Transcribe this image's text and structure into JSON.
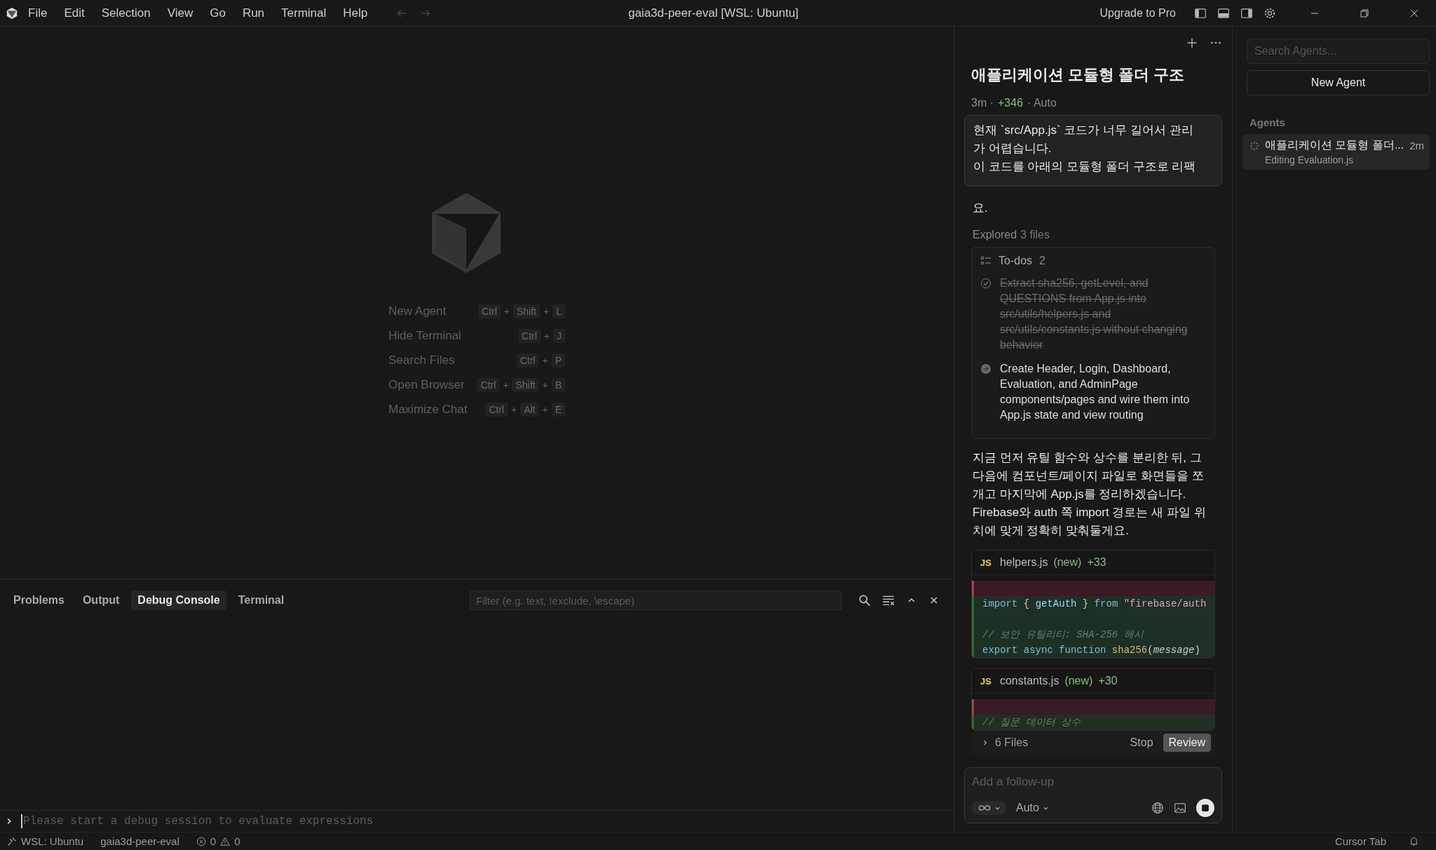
{
  "title_bar": {
    "menu": [
      "File",
      "Edit",
      "Selection",
      "View",
      "Go",
      "Run",
      "Terminal",
      "Help"
    ],
    "title": "gaia3d-peer-eval [WSL: Ubuntu]",
    "upgrade": "Upgrade to Pro"
  },
  "welcome": {
    "shortcuts": [
      {
        "label": "New Agent",
        "keys": [
          "Ctrl",
          "+",
          "Shift",
          "+",
          "L"
        ]
      },
      {
        "label": "Hide Terminal",
        "keys": [
          "Ctrl",
          "+",
          "J"
        ]
      },
      {
        "label": "Search Files",
        "keys": [
          "Ctrl",
          "+",
          "P"
        ]
      },
      {
        "label": "Open Browser",
        "keys": [
          "Ctrl",
          "+",
          "Shift",
          "+",
          "B"
        ]
      },
      {
        "label": "Maximize Chat",
        "keys": [
          "Ctrl",
          "+",
          "Alt",
          "+",
          "E"
        ]
      }
    ]
  },
  "panel": {
    "tabs": [
      {
        "label": "Problems",
        "selected": false
      },
      {
        "label": "Output",
        "selected": false
      },
      {
        "label": "Debug Console",
        "selected": true
      },
      {
        "label": "Terminal",
        "selected": false
      }
    ],
    "filter": {
      "placeholder": "Filter (e.g. text, !exclude, \\escape)"
    },
    "console": {
      "placeholder": "Please start a debug session to evaluate expressions"
    }
  },
  "chat": {
    "title": "애플리케이션 모듈형 폴더 구조",
    "meta": [
      {
        "text": "3m ·",
        "kind": "plain"
      },
      {
        "text": "+346",
        "kind": "added"
      },
      {
        "text": "· Auto",
        "kind": "plain"
      }
    ],
    "user_message": [
      "현재 `src/App.js` 코드가 너무 길어서 관리",
      "가 어렵습니다.",
      "이 코드를 아래의 모듈형 폴더 구조로 리팩"
    ],
    "reply_tail": "요.",
    "explored": {
      "label": "Explored",
      "count": "3 files"
    },
    "todos": {
      "label": "To-dos",
      "count": "2",
      "items": [
        {
          "text": "Extract sha256, getLevel, and QUESTIONS from App.js into src/utils/helpers.js and src/utils/constants.js without changing behavior",
          "done": true
        },
        {
          "text": "Create Header, Login, Dashboard, Evaluation, and AdminPage components/pages and wire them into App.js state and view routing",
          "done": false
        }
      ]
    },
    "reply": "지금 먼저 유틸 함수와 상수를 분리한 뒤, 그 다음에 컴포넌트/페이지 파일로 화면들을 쪼개고 마지막에 App.js를 정리하겠습니다. Firebase와 auth 쪽 import 경로는 새 파일 위치에 맞게 정확히 맞춰둘게요.",
    "files": [
      {
        "badge": "JS",
        "name": "helpers.js",
        "status": "(new)",
        "added": "+33",
        "lines": [
          {
            "kind": "removed"
          },
          {
            "kind": "added",
            "tokens": [
              {
                "kind": "keyword",
                "text": "import"
              },
              {
                "kind": "plain",
                "text": " { "
              },
              {
                "kind": "name",
                "text": "getAuth"
              },
              {
                "kind": "plain",
                "text": " } "
              },
              {
                "kind": "keyword",
                "text": "from"
              },
              {
                "kind": "string",
                "text": " \"firebase/auth"
              }
            ]
          },
          {
            "kind": "added"
          },
          {
            "kind": "added",
            "tokens": [
              {
                "kind": "comment",
                "text": "// 보안 유틸리티: SHA-256 해시"
              }
            ]
          },
          {
            "kind": "added",
            "tokens": [
              {
                "kind": "keyword",
                "text": "export async function"
              },
              {
                "kind": "func",
                "text": " sha256"
              },
              {
                "kind": "plain",
                "text": "("
              },
              {
                "kind": "param",
                "text": "message"
              },
              {
                "kind": "plain",
                "text": ")"
              }
            ]
          }
        ]
      },
      {
        "badge": "JS",
        "name": "constants.js",
        "status": "(new)",
        "added": "+30",
        "lines": [
          {
            "kind": "removed"
          },
          {
            "kind": "added",
            "tokens": [
              {
                "kind": "comment",
                "text": "// 질문 데이터 상수"
              }
            ]
          }
        ]
      }
    ],
    "review_bar": {
      "files": "6 Files",
      "stop": "Stop",
      "review": "Review"
    },
    "input": {
      "placeholder": "Add a follow-up",
      "mode": "Auto"
    }
  },
  "agents": {
    "search": {
      "placeholder": "Search Agents..."
    },
    "new_button": "New Agent",
    "heading": "Agents",
    "items": [
      {
        "title": "애플리케이션 모듈형 폴더...",
        "subtitle": "Editing Evaluation.js",
        "time": "2m",
        "selected": true
      }
    ]
  },
  "status_bar": {
    "remote": "WSL: Ubuntu",
    "folder": "gaia3d-peer-eval",
    "errors": "0",
    "warnings": "0",
    "right": "Cursor Tab"
  }
}
